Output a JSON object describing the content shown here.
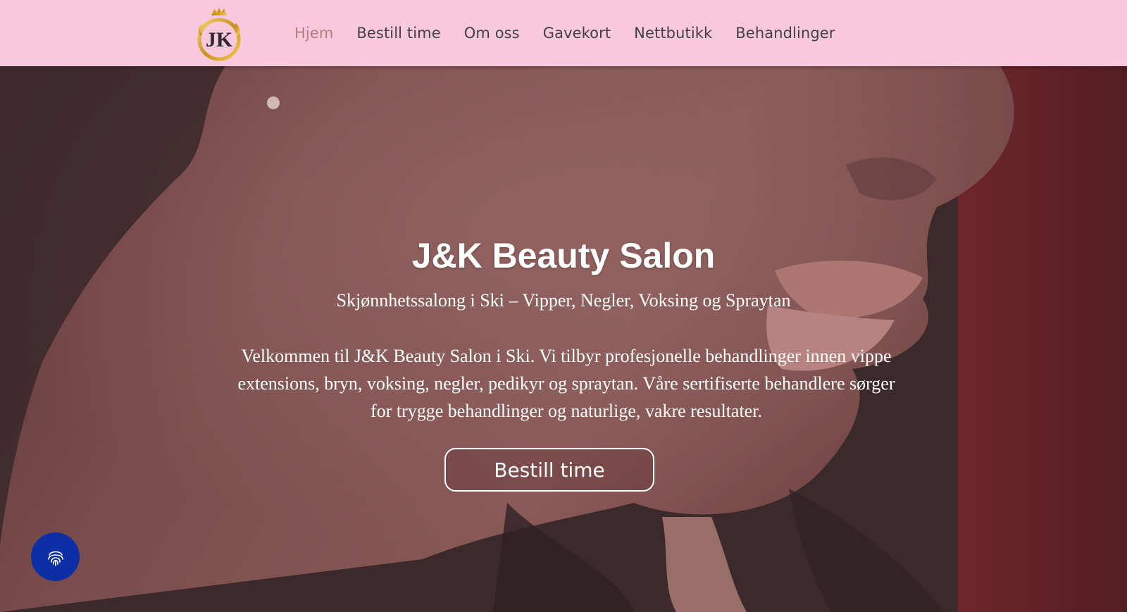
{
  "header": {
    "logo": {
      "letters": "JK",
      "icon": "crown-monogram-logo"
    },
    "nav": [
      {
        "label": "Hjem",
        "active": true
      },
      {
        "label": "Bestill time",
        "active": false
      },
      {
        "label": "Om oss",
        "active": false
      },
      {
        "label": "Gavekort",
        "active": false
      },
      {
        "label": "Nettbutikk",
        "active": false
      },
      {
        "label": "Behandlinger",
        "active": false
      }
    ]
  },
  "hero": {
    "title": "J&K Beauty Salon",
    "subtitle": "Skjønnhetssalong i Ski – Vipper, Negler, Voksing og Spraytan",
    "description": "Velkommen til J&K Beauty Salon i Ski. Vi tilbyr profesjonelle behandlinger innen vippe extensions, bryn, voksing, negler, pedikyr og spraytan. Våre sertifiserte behandlere sørger for trygge behandlinger og naturlige, vakre resultater.",
    "cta_label": "Bestill time"
  },
  "accessibility": {
    "icon": "fingerprint-icon"
  },
  "colors": {
    "header_bg": "#f8c8dc",
    "nav_text": "#444047",
    "nav_active": "#b97a7f",
    "accessibility_button": "#0d2fa6"
  }
}
